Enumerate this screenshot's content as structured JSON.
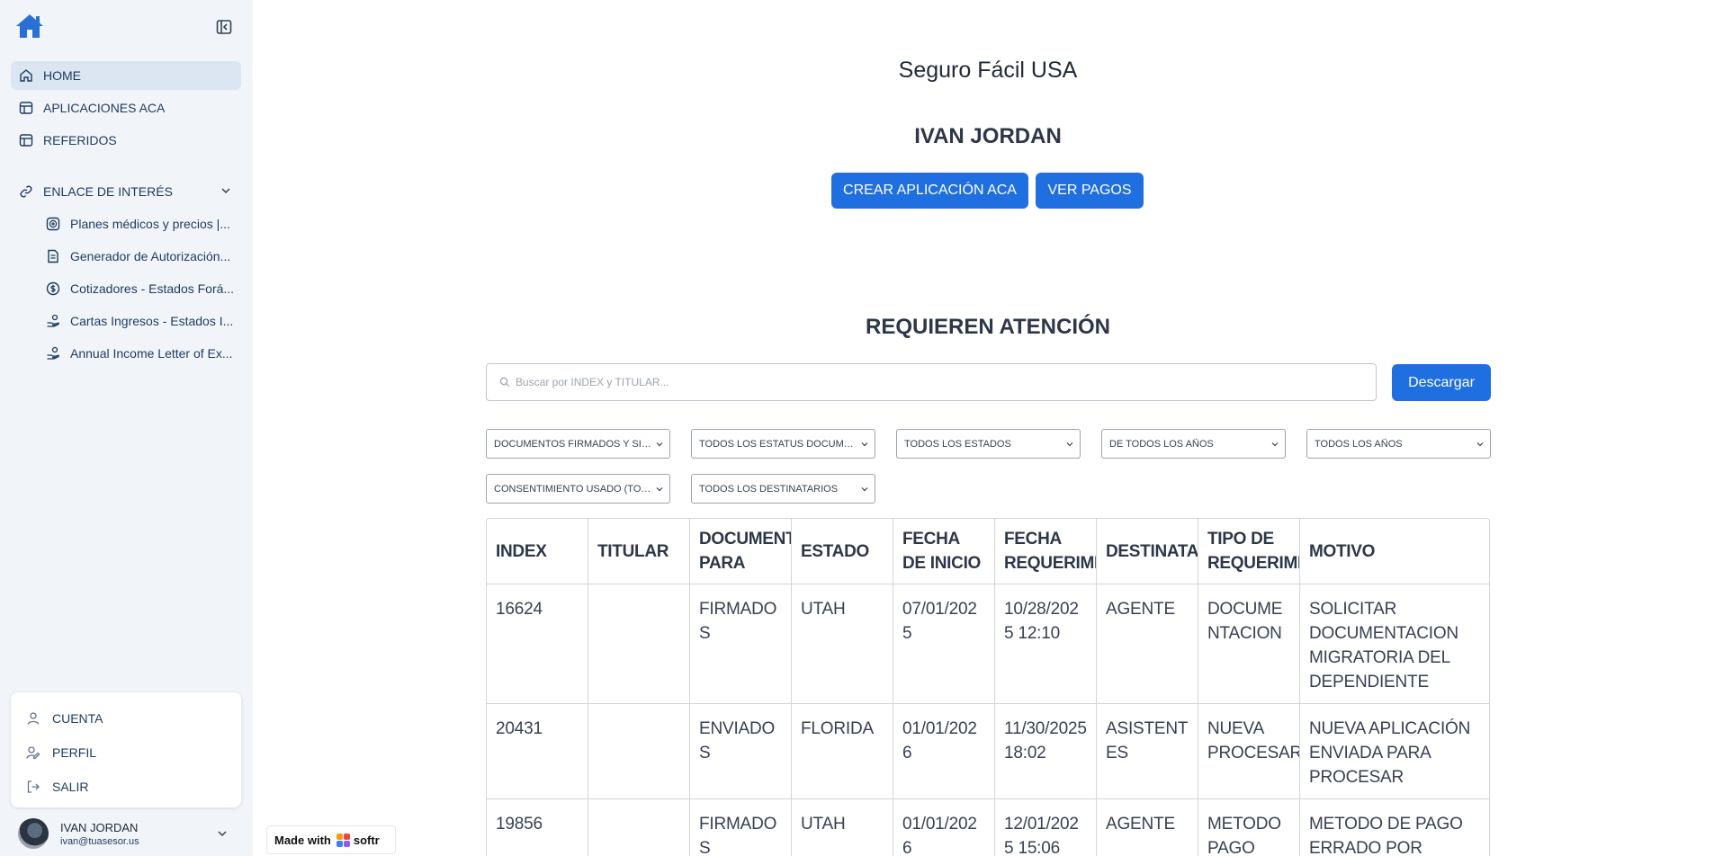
{
  "sidebar": {
    "nav": [
      {
        "label": "HOME",
        "icon": "home-icon"
      },
      {
        "label": "APLICACIONES ACA",
        "icon": "table-icon"
      },
      {
        "label": "REFERIDOS",
        "icon": "table-icon"
      }
    ],
    "group": {
      "label": "ENLACE DE INTERÉS",
      "icon": "link-icon"
    },
    "sub_items": [
      {
        "label": "Planes médicos y precios |...",
        "icon": "medical-plus-icon"
      },
      {
        "label": "Generador de Autorización...",
        "icon": "document-icon"
      },
      {
        "label": "Cotizadores - Estados Forá...",
        "icon": "dollar-icon"
      },
      {
        "label": "Cartas Ingresos - Estados I...",
        "icon": "hand-coins-icon"
      },
      {
        "label": "Annual Income Letter of Ex...",
        "icon": "hand-coins-icon"
      }
    ],
    "account_menu": [
      {
        "label": "CUENTA",
        "icon": "user-icon"
      },
      {
        "label": "PERFIL",
        "icon": "user-edit-icon"
      },
      {
        "label": "SALIR",
        "icon": "logout-icon"
      }
    ],
    "user": {
      "name": "IVAN JORDAN",
      "email": "ivan@tuasesor.us"
    }
  },
  "badge": {
    "prefix": "Made with",
    "brand": "softr"
  },
  "main": {
    "site_title": "Seguro Fácil USA",
    "user_title": "IVAN JORDAN",
    "buttons": {
      "create": "CREAR APLICACIÓN ACA",
      "payments": "VER PAGOS"
    },
    "section_title": "REQUIEREN ATENCIÓN",
    "search_placeholder": "Buscar por INDEX y TITULAR...",
    "download": "Descargar",
    "filters": [
      "DOCUMENTOS FIRMADOS Y SIN ENVIAR",
      "TODOS LOS ESTATUS DOCUMENTOS",
      "TODOS LOS ESTADOS",
      "DE TODOS LOS AÑOS",
      "TODOS LOS AÑOS",
      "CONSENTIMIENTO USADO (TODOS)",
      "TODOS LOS DESTINATARIOS"
    ]
  },
  "table": {
    "columns": [
      "INDEX",
      "TITULAR",
      "DOCUMENTOS PARA",
      "ESTADO",
      "FECHA DE INICIO",
      "FECHA REQUERIMIENTO",
      "DESTINATARIO",
      "TIPO DE REQUERIMIENTO",
      "MOTIVO"
    ],
    "rows": [
      [
        "16624",
        "",
        "FIRMADOS",
        "UTAH",
        "07/01/2025",
        "10/28/2025 12:10",
        "AGENTE",
        "DOCUMENTACION",
        "SOLICITAR DOCUMENTACION MIGRATORIA DEL DEPENDIENTE"
      ],
      [
        "20431",
        "",
        "ENVIADOS",
        "FLORIDA",
        "01/01/2026",
        "11/30/2025 18:02",
        "ASISTENTES",
        "NUEVA PROCESAR",
        "NUEVA APLICACIÓN ENVIADA PARA PROCESAR"
      ],
      [
        "19856",
        "",
        "FIRMADOS",
        "UTAH",
        "01/01/2026",
        "12/01/2025 15:06",
        "AGENTE",
        "METODO PAGO",
        "METODO DE PAGO ERRADO POR FAVOR"
      ]
    ]
  },
  "colors": {
    "accent": "#1f6fe0",
    "sidebar_bg": "#f1f5f9",
    "active_bg": "#dbe6f2"
  }
}
